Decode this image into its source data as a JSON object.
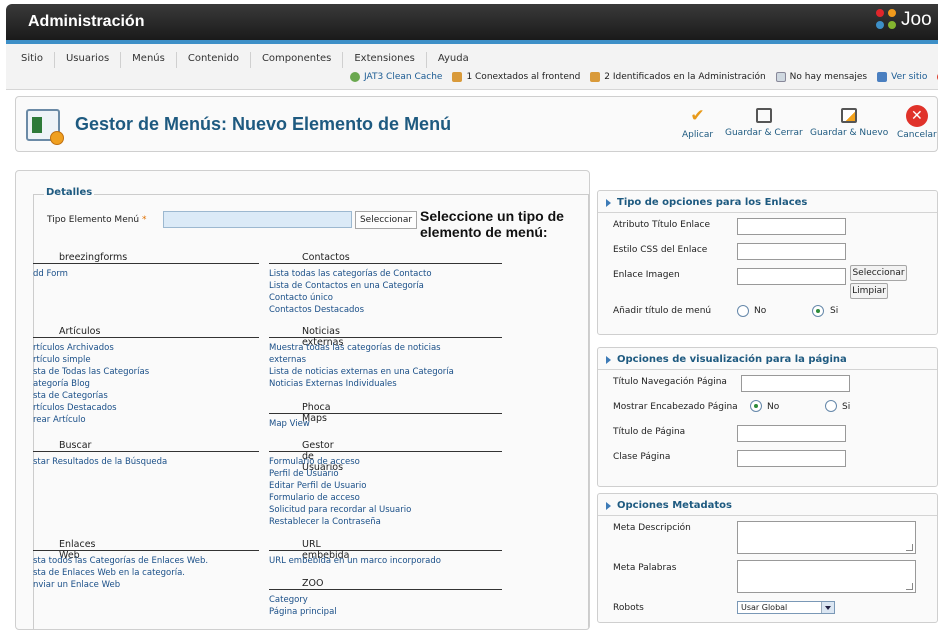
{
  "header": {
    "title": "Administración",
    "logo_text": "Joo"
  },
  "menu": [
    "Sitio",
    "Usuarios",
    "Menús",
    "Contenido",
    "Componentes",
    "Extensiones",
    "Ayuda"
  ],
  "status": {
    "cache": "JAT3 Clean Cache",
    "frontend": "1 Conextados al frontend",
    "admin": "2 Identificados en la Administración",
    "messages": "No hay mensajes",
    "site": "Ver sitio"
  },
  "toolbar": {
    "title": "Gestor de Menús: Nuevo Elemento de Menú",
    "apply": "Aplicar",
    "save_close": "Guardar & Cerrar",
    "save_new": "Guardar & Nuevo",
    "cancel": "Cancelar"
  },
  "details": {
    "legend": "Detalles",
    "type_label": "Tipo Elemento Menú",
    "required_mark": "*",
    "select_button": "Seleccionar",
    "select_message": "Seleccione un tipo de elemento de menú:"
  },
  "groups": {
    "breezingforms": {
      "title": "breezingforms",
      "items": [
        "dd Form"
      ]
    },
    "contactos": {
      "title": "Contactos",
      "items": [
        "Lista todas las categorías de Contacto",
        "Lista de Contactos en una Categoría",
        "Contacto único",
        "Contactos Destacados"
      ]
    },
    "articulos": {
      "title": "Artículos",
      "items": [
        "rtículos Archivados",
        "rtículo simple",
        "sta de Todas las Categorías",
        "ategoría Blog",
        "sta de Categorías",
        "rtículos Destacados",
        "rear Artículo"
      ]
    },
    "noticias": {
      "title": "Noticias externas",
      "items": [
        "Muestra todas las categorías de noticias",
        "externas",
        "Lista de noticias externas en una Categoría",
        "Noticias Externas Individuales"
      ]
    },
    "phoca": {
      "title": "Phoca Maps",
      "items": [
        "Map View"
      ]
    },
    "buscar": {
      "title": "Buscar",
      "items": [
        "star Resultados de la Búsqueda"
      ]
    },
    "usuarios": {
      "title": "Gestor de Usuarios",
      "items": [
        "Formulario de acceso",
        "Perfil de Usuario",
        "Editar Perfil de Usuario",
        "Formulario de acceso",
        "Solicitud para recordar al Usuario",
        "Restablecer la Contraseña"
      ]
    },
    "enlaces": {
      "title": "Enlaces Web",
      "items": [
        "sta todos las Categorías de Enlaces Web.",
        "sta de Enlaces Web en la categoría.",
        "nviar un Enlace Web"
      ]
    },
    "url": {
      "title": "URL embebida",
      "items": [
        "URL embebida en un marco incorporado"
      ]
    },
    "zoo": {
      "title": "ZOO",
      "items": [
        "Category",
        "Página principal"
      ]
    }
  },
  "link_options": {
    "title": "Tipo de opciones para los Enlaces",
    "title_attr_label": "Atributo Título Enlace",
    "css_label": "Estilo CSS del Enlace",
    "image_label": "Enlace Imagen",
    "select_button": "Seleccionar",
    "clear_button": "Limpiar",
    "add_title_label": "Añadir título de menú",
    "radio_no": "No",
    "radio_yes": "Si",
    "add_title_selected": "Si"
  },
  "page_display": {
    "title": "Opciones de visualización para la página",
    "nav_title_label": "Título Navegación Página",
    "show_heading_label": "Mostrar Encabezado Página",
    "radio_no": "No",
    "radio_yes": "Si",
    "show_heading_selected": "No",
    "page_title_label": "Título de Página",
    "page_class_label": "Clase Página"
  },
  "metadata": {
    "title": "Opciones Metadatos",
    "description_label": "Meta Descripción",
    "keywords_label": "Meta Palabras",
    "robots_label": "Robots",
    "robots_value": "Usar Global"
  },
  "colors": {
    "accent": "#1e5a80",
    "link": "#1a4f88",
    "topbar": "#1a1a1a",
    "bluebar": "#3d8fc7"
  }
}
